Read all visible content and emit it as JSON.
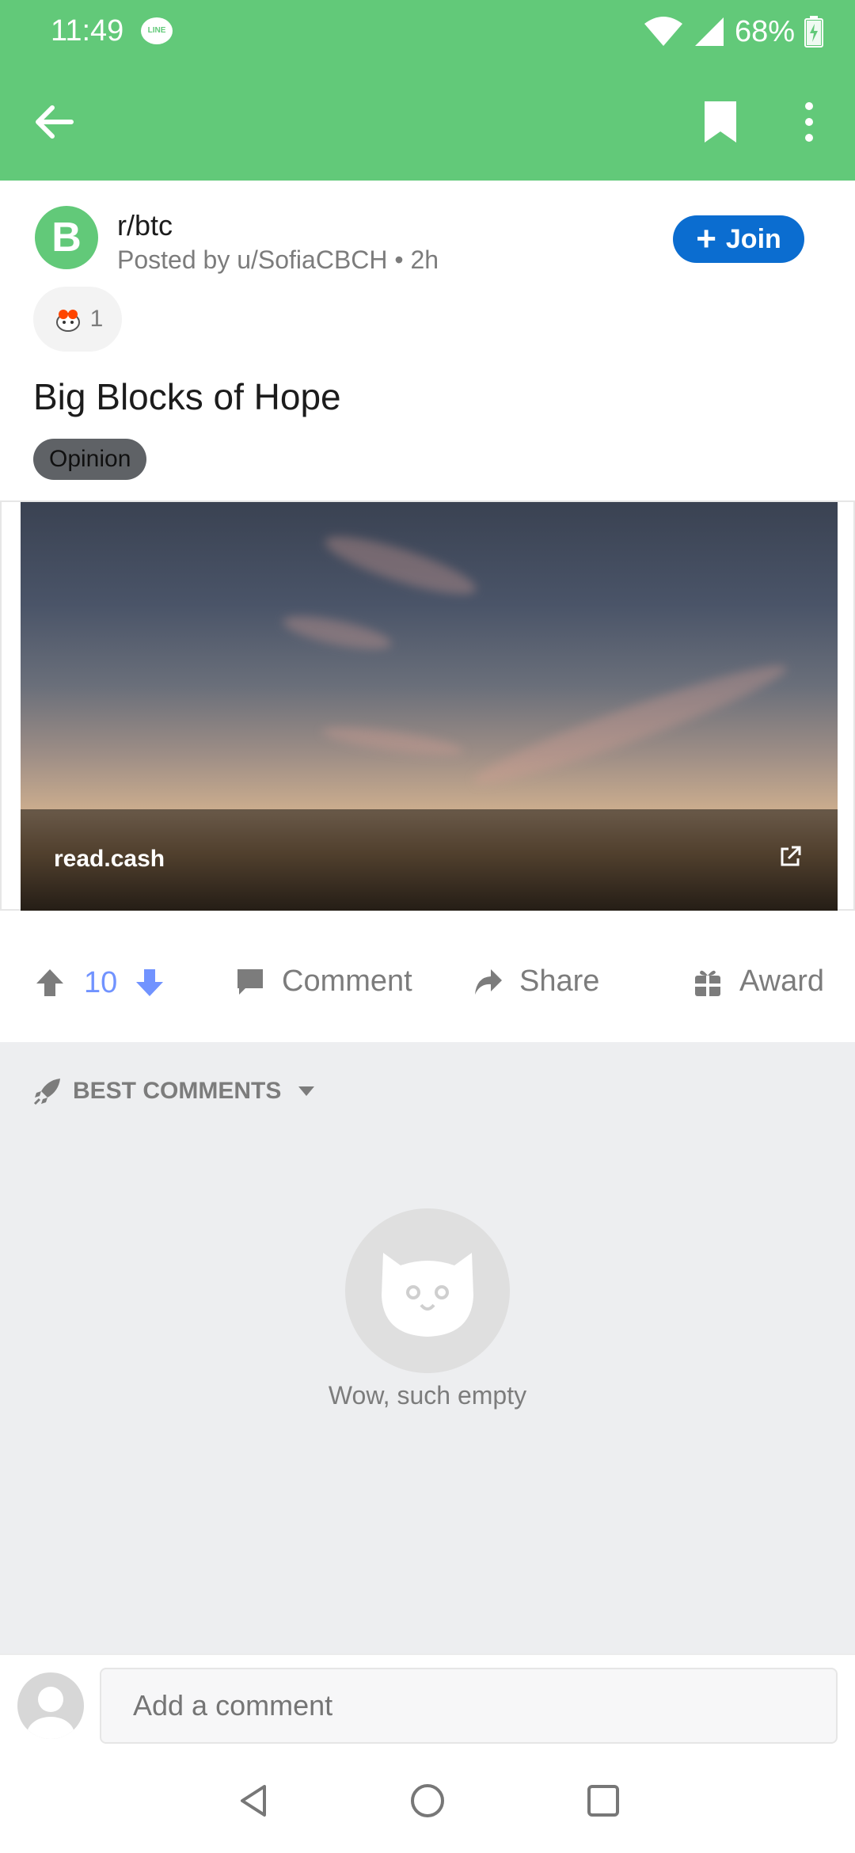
{
  "status_bar": {
    "time": "11:49",
    "line_badge": "LINE",
    "battery": "68%"
  },
  "app_bar": {
    "icons": [
      "back-arrow-icon",
      "bookmark-icon",
      "more-vert-icon"
    ],
    "color": "#62c979"
  },
  "post": {
    "subreddit": "r/btc",
    "subreddit_avatar_glyph": "B",
    "posted_by": "Posted by u/SofiaCBCH • 2h",
    "join_label": "Join",
    "award_count": "1",
    "title": "Big Blocks of Hope",
    "flair": "Opinion",
    "link_source": "read.cash"
  },
  "actions": {
    "vote_count": "10",
    "comment_label": "Comment",
    "share_label": "Share",
    "award_label": "Award"
  },
  "comments": {
    "sort_label": "BEST COMMENTS",
    "empty_text": "Wow, such empty"
  },
  "comment_bar": {
    "placeholder": "Add a comment"
  },
  "colors": {
    "accent_green": "#62c979",
    "join_blue": "#0b6dd0",
    "upvote_blue": "#7193ff"
  }
}
